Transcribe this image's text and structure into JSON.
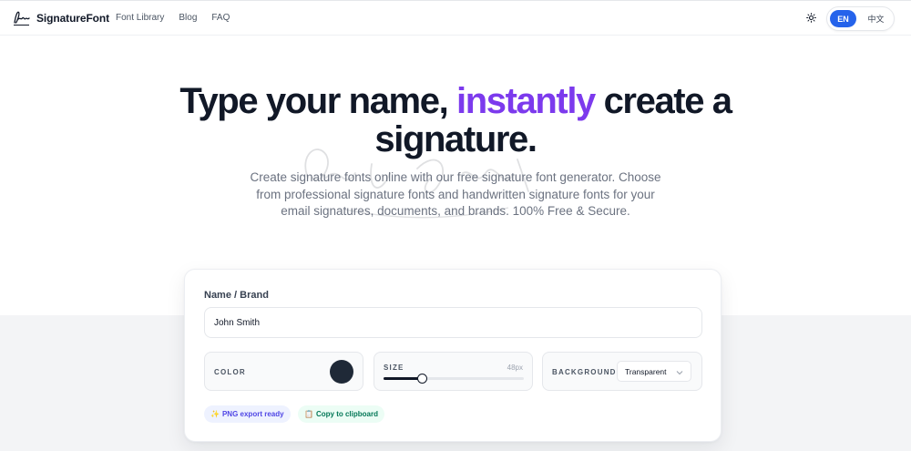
{
  "app": {
    "brand": "SignatureFont"
  },
  "nav": {
    "items": [
      "Font Library",
      "Blog",
      "FAQ"
    ]
  },
  "language": {
    "options": [
      "EN",
      "中文"
    ],
    "active": "EN"
  },
  "hero": {
    "title_part1": "Type your name, ",
    "title_accent": "instantly",
    "title_part2": " create a signature.",
    "subtitle": "Create signature fonts online with our free signature font generator. Choose from professional signature fonts and handwritten signature fonts for your email signatures, documents, and brands. 100% Free & Secure.",
    "accent_color": "#7c3aed"
  },
  "generator": {
    "name_label": "Name / Brand",
    "name_value": "John Smith",
    "color_label": "COLOR",
    "color_value": "#1f2937",
    "size_label": "SIZE",
    "size_value": "48px",
    "size_fraction": 0.26,
    "background_label": "BACKGROUND",
    "background_value": "Transparent",
    "badges": {
      "png": "PNG export ready",
      "copy": "Copy to clipboard"
    }
  },
  "icons": {
    "logo": "signature-logo-icon",
    "theme": "sun-icon",
    "select": "chevron-down-icon",
    "png_badge": "sparkle-icon",
    "copy_badge": "clipboard-icon"
  }
}
